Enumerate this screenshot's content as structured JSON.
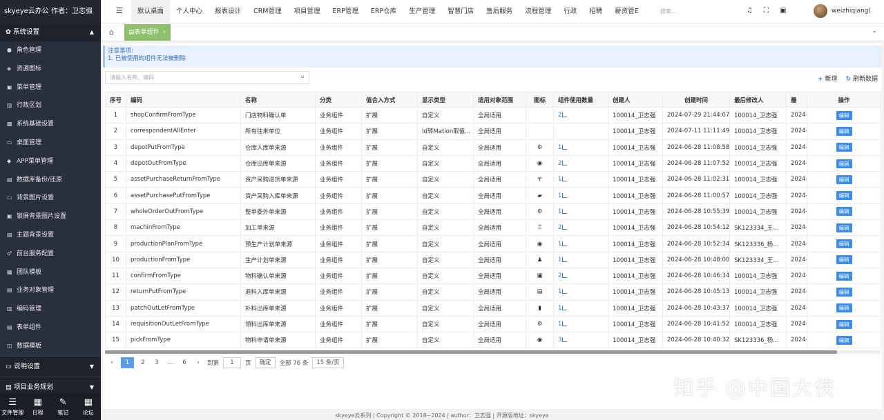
{
  "brand": "skyeye云办公 作者：卫志强",
  "sidebar": {
    "group": "系统设置",
    "items": [
      {
        "label": "角色管理",
        "icon": "role-icon"
      },
      {
        "label": "资源图标",
        "icon": "resource-icon"
      },
      {
        "label": "菜单管理",
        "icon": "menu-icon"
      },
      {
        "label": "行政区划",
        "icon": "region-icon"
      },
      {
        "label": "系统基础设置",
        "icon": "settings-icon"
      },
      {
        "label": "桌面管理",
        "icon": "desktop-icon"
      },
      {
        "label": "APP菜单管理",
        "icon": "app-icon"
      },
      {
        "label": "数据库备份/还原",
        "icon": "database-icon"
      },
      {
        "label": "背景图片设置",
        "icon": "image-icon"
      },
      {
        "label": "锁屏背景图片设置",
        "icon": "lock-image-icon"
      },
      {
        "label": "主题背景设置",
        "icon": "theme-icon"
      },
      {
        "label": "前台服务配置",
        "icon": "service-icon"
      },
      {
        "label": "团队模板",
        "icon": "team-icon"
      },
      {
        "label": "业务对象管理",
        "icon": "object-icon"
      },
      {
        "label": "编码管理",
        "icon": "code-icon"
      },
      {
        "label": "表单组件",
        "icon": "form-icon"
      },
      {
        "label": "数据模板",
        "icon": "template-icon"
      }
    ],
    "sections": [
      "说明设置",
      "项目业务规划"
    ],
    "bottom": [
      {
        "label": "文件管理",
        "icon": "list-icon"
      },
      {
        "label": "日程",
        "icon": "calendar-icon"
      },
      {
        "label": "笔记",
        "icon": "note-icon"
      },
      {
        "label": "论坛",
        "icon": "forum-icon"
      }
    ]
  },
  "topnav": {
    "items": [
      "默认桌面",
      "个人中心",
      "报表设计",
      "CRM管理",
      "项目管理",
      "ERP管理",
      "ERP仓库",
      "生产管理",
      "智慧门店",
      "售后服务",
      "流程管理",
      "行政",
      "招聘",
      "薪资管E"
    ],
    "search_placeholder": "搜索...",
    "username": "weizhiqiang("
  },
  "tabs": {
    "current": "表单组件"
  },
  "notice": {
    "title": "注意事项:",
    "line1": "1. 已被使用的组件无法被删除"
  },
  "search": {
    "placeholder": "请输入名称、编码"
  },
  "toolbar": {
    "add": "新增",
    "refresh": "刷新数据"
  },
  "table": {
    "headers": [
      "序号",
      "编码",
      "名称",
      "分类",
      "值合入方式",
      "显示类型",
      "适用对象范围",
      "图标",
      "组件使用数量",
      "创建人",
      "创建时间",
      "最后修改人",
      "最",
      "操作"
    ],
    "edit_label": "编辑",
    "rows": [
      {
        "no": "1",
        "code": "shopConfirmFromType",
        "name": "门店物料确认单",
        "cat": "业务组件",
        "way": "扩展",
        "display": "自定义",
        "scope": "全局适用",
        "icon": "",
        "count": "2",
        "creator": "100014_卫志强",
        "time": "2024-07-29 21:44:07",
        "modifier": "100014_卫志强",
        "last": "2024-"
      },
      {
        "no": "2",
        "code": "correspondentAllEnter",
        "name": "所有往来单位",
        "cat": "业务组件",
        "way": "扩展",
        "display": "Id转Mation取值...",
        "scope": "全局适用",
        "icon": "",
        "count": "",
        "creator": "100014_卫志强",
        "time": "2024-07-11 11:11:49",
        "modifier": "100014_卫志强",
        "last": "2024-"
      },
      {
        "no": "3",
        "code": "depotPutFromType",
        "name": "仓库入库单来源",
        "cat": "业务组件",
        "way": "扩展",
        "display": "自定义",
        "scope": "全局适用",
        "icon": "⚙",
        "count": "1",
        "creator": "100014_卫志强",
        "time": "2024-06-28 11:08:58",
        "modifier": "100014_卫志强",
        "last": "2024-"
      },
      {
        "no": "4",
        "code": "depotOutFromType",
        "name": "仓库出库单来源",
        "cat": "业务组件",
        "way": "扩展",
        "display": "自定义",
        "scope": "全局适用",
        "icon": "◉",
        "count": "2",
        "creator": "100014_卫志强",
        "time": "2024-06-28 11:07:52",
        "modifier": "100014_卫志强",
        "last": "2024-"
      },
      {
        "no": "5",
        "code": "assetPurchaseReturnFromType",
        "name": "资产采购退货单来源",
        "cat": "业务组件",
        "way": "扩展",
        "display": "自定义",
        "scope": "全局适用",
        "icon": "〒",
        "count": "1",
        "creator": "100014_卫志强",
        "time": "2024-06-28 11:02:31",
        "modifier": "100014_卫志强",
        "last": "2024-"
      },
      {
        "no": "6",
        "code": "assetPurchasePutFromType",
        "name": "资产采购入库单来源",
        "cat": "业务组件",
        "way": "扩展",
        "display": "自定义",
        "scope": "全局适用",
        "icon": "▰",
        "count": "1",
        "creator": "100014_卫志强",
        "time": "2024-06-28 11:00:57",
        "modifier": "100014_卫志强",
        "last": "2024-"
      },
      {
        "no": "7",
        "code": "wholeOrderOutFromType",
        "name": "整单委外单来源",
        "cat": "业务组件",
        "way": "扩展",
        "display": "自定义",
        "scope": "全局适用",
        "icon": "⚙",
        "count": "1",
        "creator": "100014_卫志强",
        "time": "2024-06-28 10:55:39",
        "modifier": "100014_卫志强",
        "last": "2024-"
      },
      {
        "no": "8",
        "code": "machinFromType",
        "name": "加工单来源",
        "cat": "业务组件",
        "way": "扩展",
        "display": "自定义",
        "scope": "全局适用",
        "icon": "♖",
        "count": "2",
        "creator": "100014_卫志强",
        "time": "2024-06-28 10:54:12",
        "modifier": "SK123334_王...",
        "last": "2024-"
      },
      {
        "no": "9",
        "code": "productionPlanFromType",
        "name": "预生产计划单来源",
        "cat": "业务组件",
        "way": "扩展",
        "display": "自定义",
        "scope": "全局适用",
        "icon": "◉",
        "count": "1",
        "creator": "100014_卫志强",
        "time": "2024-06-28 10:52:34",
        "modifier": "SK123336_杨...",
        "last": "2024-"
      },
      {
        "no": "10",
        "code": "productionFromType",
        "name": "生产计划单来源",
        "cat": "业务组件",
        "way": "扩展",
        "display": "自定义",
        "scope": "全局适用",
        "icon": "♟",
        "count": "1",
        "creator": "100014_卫志强",
        "time": "2024-06-28 10:48:00",
        "modifier": "SK123334_王...",
        "last": "2024-"
      },
      {
        "no": "11",
        "code": "confirmFromType",
        "name": "物料确认单来源",
        "cat": "业务组件",
        "way": "扩展",
        "display": "自定义",
        "scope": "全局适用",
        "icon": "▣",
        "count": "2",
        "creator": "100014_卫志强",
        "time": "2024-06-28 10:46:34",
        "modifier": "100014_卫志强",
        "last": "2024-"
      },
      {
        "no": "12",
        "code": "returnPutFromType",
        "name": "退料入库单来源",
        "cat": "业务组件",
        "way": "扩展",
        "display": "自定义",
        "scope": "全局适用",
        "icon": "▤",
        "count": "1",
        "creator": "100014_卫志强",
        "time": "2024-06-28 10:45:13",
        "modifier": "100014_卫志强",
        "last": "2024-"
      },
      {
        "no": "13",
        "code": "patchOutLetFromType",
        "name": "补料出库单来源",
        "cat": "业务组件",
        "way": "扩展",
        "display": "自定义",
        "scope": "全局适用",
        "icon": "▮",
        "count": "1",
        "creator": "100014_卫志强",
        "time": "2024-06-28 10:43:37",
        "modifier": "100014_卫志强",
        "last": "2024-"
      },
      {
        "no": "14",
        "code": "requisitionOutLetFromType",
        "name": "领料出库单来源",
        "cat": "业务组件",
        "way": "扩展",
        "display": "自定义",
        "scope": "全局适用",
        "icon": "⚙",
        "count": "1",
        "creator": "100014_卫志强",
        "time": "2024-06-28 10:41:52",
        "modifier": "100014_卫志强",
        "last": "2024-"
      },
      {
        "no": "15",
        "code": "pickFromType",
        "name": "物料申请单来源",
        "cat": "业务组件",
        "way": "扩展",
        "display": "自定义",
        "scope": "全局适用",
        "icon": "◉",
        "count": "3",
        "creator": "100014_卫志强",
        "time": "2024-06-28 10:40:32",
        "modifier": "SK123336_杨...",
        "last": "2024-"
      }
    ]
  },
  "pager": {
    "prev": "‹",
    "pages": [
      "1",
      "2",
      "3",
      "...",
      "6"
    ],
    "current": "1",
    "next": "›",
    "goto_label": "到第",
    "goto_value": "1",
    "page_unit": "页",
    "confirm": "确定",
    "total": "全部 76 条",
    "size": "15 条/页"
  },
  "footer": "skyeye云系列 | Copyright © 2018~2024 | author：卫志强 | 开源版地址：skyeye",
  "watermark": "知乎 @中国大侠"
}
